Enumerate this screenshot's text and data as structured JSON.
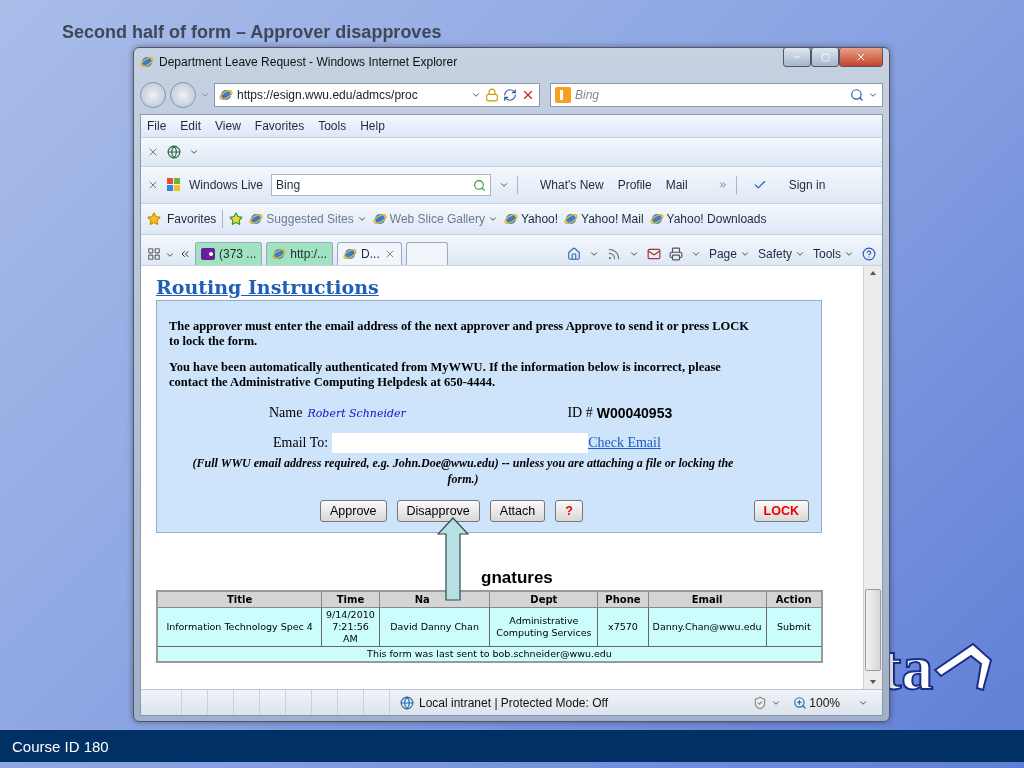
{
  "slide": {
    "title": "Second half of form – Approver disapproves",
    "logo_text": "ta",
    "footer": "Course ID 180"
  },
  "window": {
    "title": "Department Leave Request - Windows Internet Explorer"
  },
  "address_bar": {
    "url": "https://esign.wwu.edu/admcs/proc"
  },
  "search_box": {
    "placeholder": "Bing"
  },
  "menu": [
    "File",
    "Edit",
    "View",
    "Favorites",
    "Tools",
    "Help"
  ],
  "live_toolbar": {
    "brand": "Windows Live",
    "search_value": "Bing",
    "links": [
      "What's New",
      "Profile",
      "Mail"
    ],
    "sign_in": "Sign in"
  },
  "favorites_bar": {
    "label": "Favorites",
    "items": [
      {
        "label": "Suggested Sites",
        "has_menu": true,
        "dimmed": true
      },
      {
        "label": "Web Slice Gallery",
        "has_menu": true,
        "dimmed": true
      },
      {
        "label": "Yahoo!",
        "has_menu": false,
        "dimmed": false
      },
      {
        "label": "Yahoo! Mail",
        "has_menu": false,
        "dimmed": false
      },
      {
        "label": "Yahoo! Downloads",
        "has_menu": false,
        "dimmed": false
      }
    ]
  },
  "tabs": [
    {
      "label": "(373 ...",
      "kind": "yahoo",
      "selected": false
    },
    {
      "label": "http:/...",
      "kind": "ie",
      "selected": false
    },
    {
      "label": "D...",
      "kind": "ie",
      "selected": true
    }
  ],
  "command_bar": [
    "Page",
    "Safety",
    "Tools"
  ],
  "routing": {
    "heading": "Routing Instructions",
    "paragraphs": [
      "The approver must enter the email address of the next approver and press Approve to send it or press LOCK to lock the form.",
      "You have been automatically authenticated from MyWWU. If the information below is incorrect, please contact the Administrative Computing Helpdesk at 650-4444."
    ],
    "name_label": "Name",
    "name_value": "Robert Schneider",
    "id_label": "ID #",
    "id_value": "W00040953",
    "email_label": "Email To:",
    "check_email": "Check Email",
    "note": "(Full WWU email address required, e.g. John.Doe@wwu.edu) -- unless you are attaching a file or locking the form.)",
    "buttons": [
      {
        "label": "Approve",
        "kind": "normal"
      },
      {
        "label": "Disapprove",
        "kind": "normal"
      },
      {
        "label": "Attach",
        "kind": "normal"
      },
      {
        "label": "?",
        "kind": "help"
      },
      {
        "label": "LOCK",
        "kind": "lock"
      }
    ]
  },
  "signatures": {
    "heading": "gnatures",
    "columns": [
      "Title",
      "Time",
      "Na",
      "Dept",
      "Phone",
      "Email",
      "Action"
    ],
    "rows": [
      {
        "cells": [
          "Information Technology Spec 4",
          "9/14/2010 7:21:56 AM",
          "David Danny Chan",
          "Administrative Computing Services",
          "x7570",
          "Danny.Chan@wwu.edu",
          "Submit"
        ]
      }
    ],
    "footer": "This form was last sent to bob.schneider@wwu.edu"
  },
  "status_bar": {
    "zone": "Local intranet | Protected Mode: Off",
    "zoom": "100%"
  }
}
